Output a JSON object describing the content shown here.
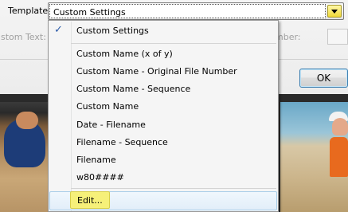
{
  "template": {
    "label": "Template:",
    "value": "Custom Settings"
  },
  "ghost": {
    "left_label": "ustom Text:",
    "right_label": "mber:"
  },
  "buttons": {
    "ok": "OK"
  },
  "dropdown": {
    "selected_check": "✓",
    "items": [
      "Custom Settings",
      "Custom Name (x of y)",
      "Custom Name - Original File Number",
      "Custom Name - Sequence",
      "Custom Name",
      "Date - Filename",
      "Filename - Sequence",
      "Filename",
      "w80####"
    ],
    "edit": "Edit..."
  },
  "colors": {
    "highlight": "#f6f079",
    "hover_row": "#e2eef9",
    "arrow_button": "#f0d836"
  }
}
